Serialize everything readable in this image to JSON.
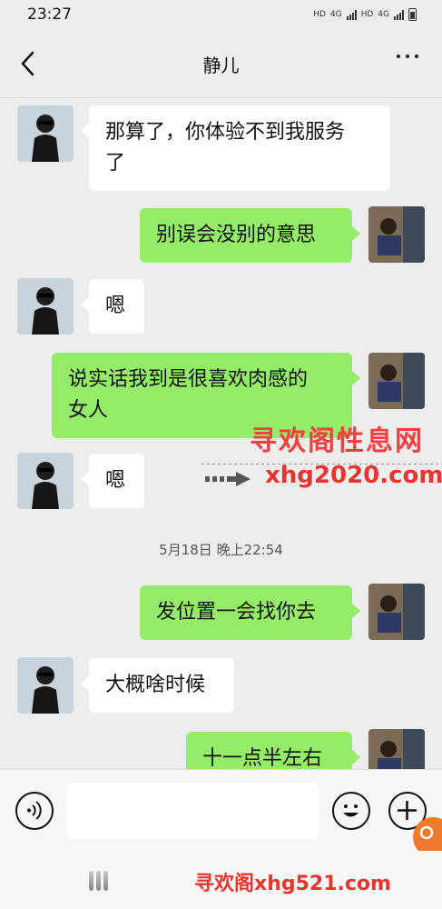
{
  "status": {
    "time": "23:27",
    "hd1": "HD",
    "net1": "4G",
    "hd2": "HD",
    "net2": "4G"
  },
  "header": {
    "title": "静儿"
  },
  "messages": [
    {
      "side": "left",
      "text_line1": "那算了，你体验不到我服务",
      "text_line2": "了"
    },
    {
      "side": "right",
      "text": "别误会没别的意思"
    },
    {
      "side": "left",
      "text": "嗯"
    },
    {
      "side": "right",
      "text_line1": "说实话我到是很喜欢肉感的",
      "text_line2": "女人"
    },
    {
      "side": "left",
      "text": "嗯"
    },
    {
      "side": "right",
      "text": "发位置一会找你去"
    },
    {
      "side": "left",
      "text": "大概啥时候"
    },
    {
      "side": "right",
      "text": "十一点半左右"
    }
  ],
  "timestamp": "5月18日 晚上22:54",
  "watermark": {
    "line1": "寻欢阁性息网",
    "line2": "xhg2020.com",
    "bottom": "寻欢阁xhg521.com"
  },
  "colors": {
    "bubble_right": "#95ec69",
    "bubble_left": "#ffffff",
    "background": "#ededed",
    "watermark": "#e8332f"
  },
  "icons": {
    "back": "chevron-left-icon",
    "more": "more-dots-icon",
    "voice": "voice-icon",
    "emoji": "emoji-icon",
    "plus": "plus-icon"
  }
}
